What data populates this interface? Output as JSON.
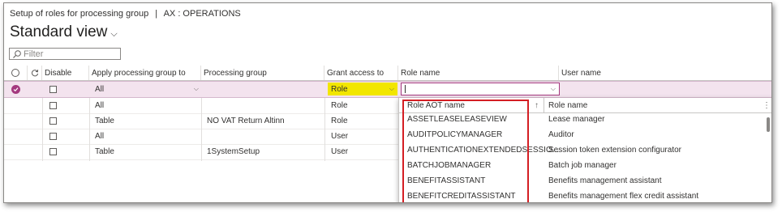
{
  "breadcrumb": {
    "title": "Setup of roles for processing group",
    "separator": "|",
    "context": "AX : OPERATIONS"
  },
  "view": {
    "title": "Standard view",
    "chevron": "⌵"
  },
  "filter": {
    "placeholder": "Filter"
  },
  "columns": {
    "disable": "Disable",
    "apply": "Apply processing group to",
    "group": "Processing group",
    "grant": "Grant access to",
    "role": "Role name",
    "user": "User name"
  },
  "selected_row": {
    "apply": "All",
    "grant": "Role",
    "role": ""
  },
  "rows": [
    {
      "apply": "All",
      "group": "",
      "grant": "Role"
    },
    {
      "apply": "Table",
      "group": "NO VAT Return Altinn",
      "grant": "Role"
    },
    {
      "apply": "All",
      "group": "",
      "grant": "User"
    },
    {
      "apply": "Table",
      "group": "1SystemSetup",
      "grant": "User"
    }
  ],
  "lookup": {
    "col_aot": "Role AOT name",
    "col_name": "Role name",
    "sort_icon": "↑",
    "more_icon": "⋮",
    "items": [
      {
        "aot": "ASSETLEASELEASEVIEW",
        "name": "Lease manager"
      },
      {
        "aot": "AUDITPOLICYMANAGER",
        "name": "Auditor"
      },
      {
        "aot": "AUTHENTICATIONEXTENDEDSESSIO...",
        "name": "Session token extension configurator"
      },
      {
        "aot": "BATCHJOBMANAGER",
        "name": "Batch job manager"
      },
      {
        "aot": "BENEFITASSISTANT",
        "name": "Benefits management assistant"
      },
      {
        "aot": "BENEFITCREDITASSISTANT",
        "name": "Benefits management flex credit assistant"
      }
    ]
  },
  "colors": {
    "accent": "#a4397f",
    "selected_bg": "#f3e3ee",
    "grant_highlight": "#f2e600",
    "callout_red": "#d41e23"
  }
}
